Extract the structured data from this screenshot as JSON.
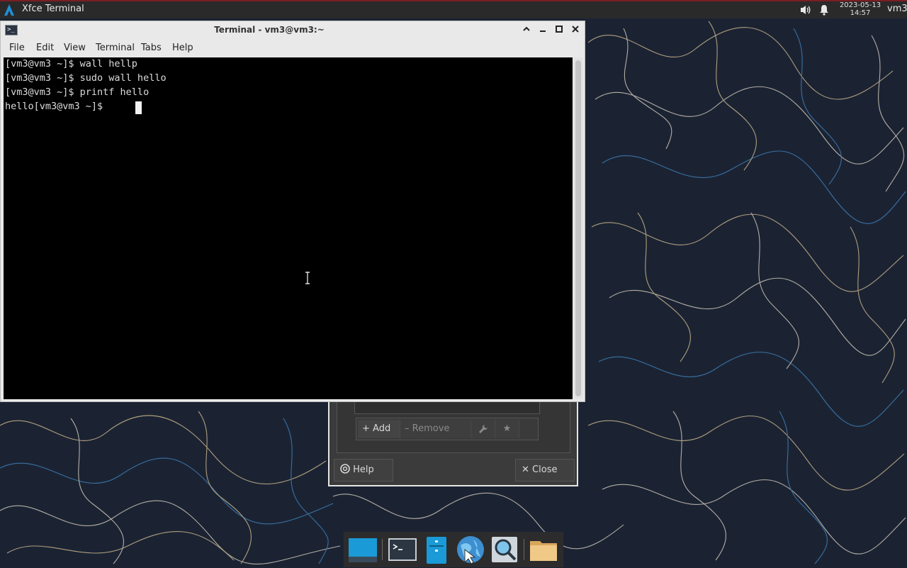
{
  "panel": {
    "app_title": "Xfce Terminal",
    "date": "2023-05-13",
    "time": "14:57",
    "user": "vm3",
    "icons": [
      "app-menu-icon",
      "volume-icon",
      "notification-bell-icon"
    ]
  },
  "terminal": {
    "title": "Terminal - vm3@vm3:~",
    "menu": [
      "File",
      "Edit",
      "View",
      "Terminal",
      "Tabs",
      "Help"
    ],
    "lines": [
      "[vm3@vm3 ~]$ wall hellp",
      "[vm3@vm3 ~]$ sudo wall hello",
      "[vm3@vm3 ~]$ printf hello",
      "hello[vm3@vm3 ~]$ "
    ],
    "window_buttons": [
      "shade-icon",
      "minimize-icon",
      "maximize-icon",
      "close-icon"
    ]
  },
  "background_dialog": {
    "toolbar": {
      "add_label": "Add",
      "remove_label": "Remove"
    },
    "help_label": "Help",
    "close_label": "Close"
  },
  "dock": {
    "items": [
      "show-desktop-icon",
      "terminal-icon",
      "file-manager-icon",
      "web-browser-icon",
      "app-finder-icon",
      "folder-icon"
    ]
  },
  "colors": {
    "desktop_bg": "#1b2333",
    "panel_bg": "#2a2a2a",
    "panel_accent": "#7a1f24",
    "terminal_bg": "#000000",
    "terminal_fg": "#dcdcdc"
  }
}
